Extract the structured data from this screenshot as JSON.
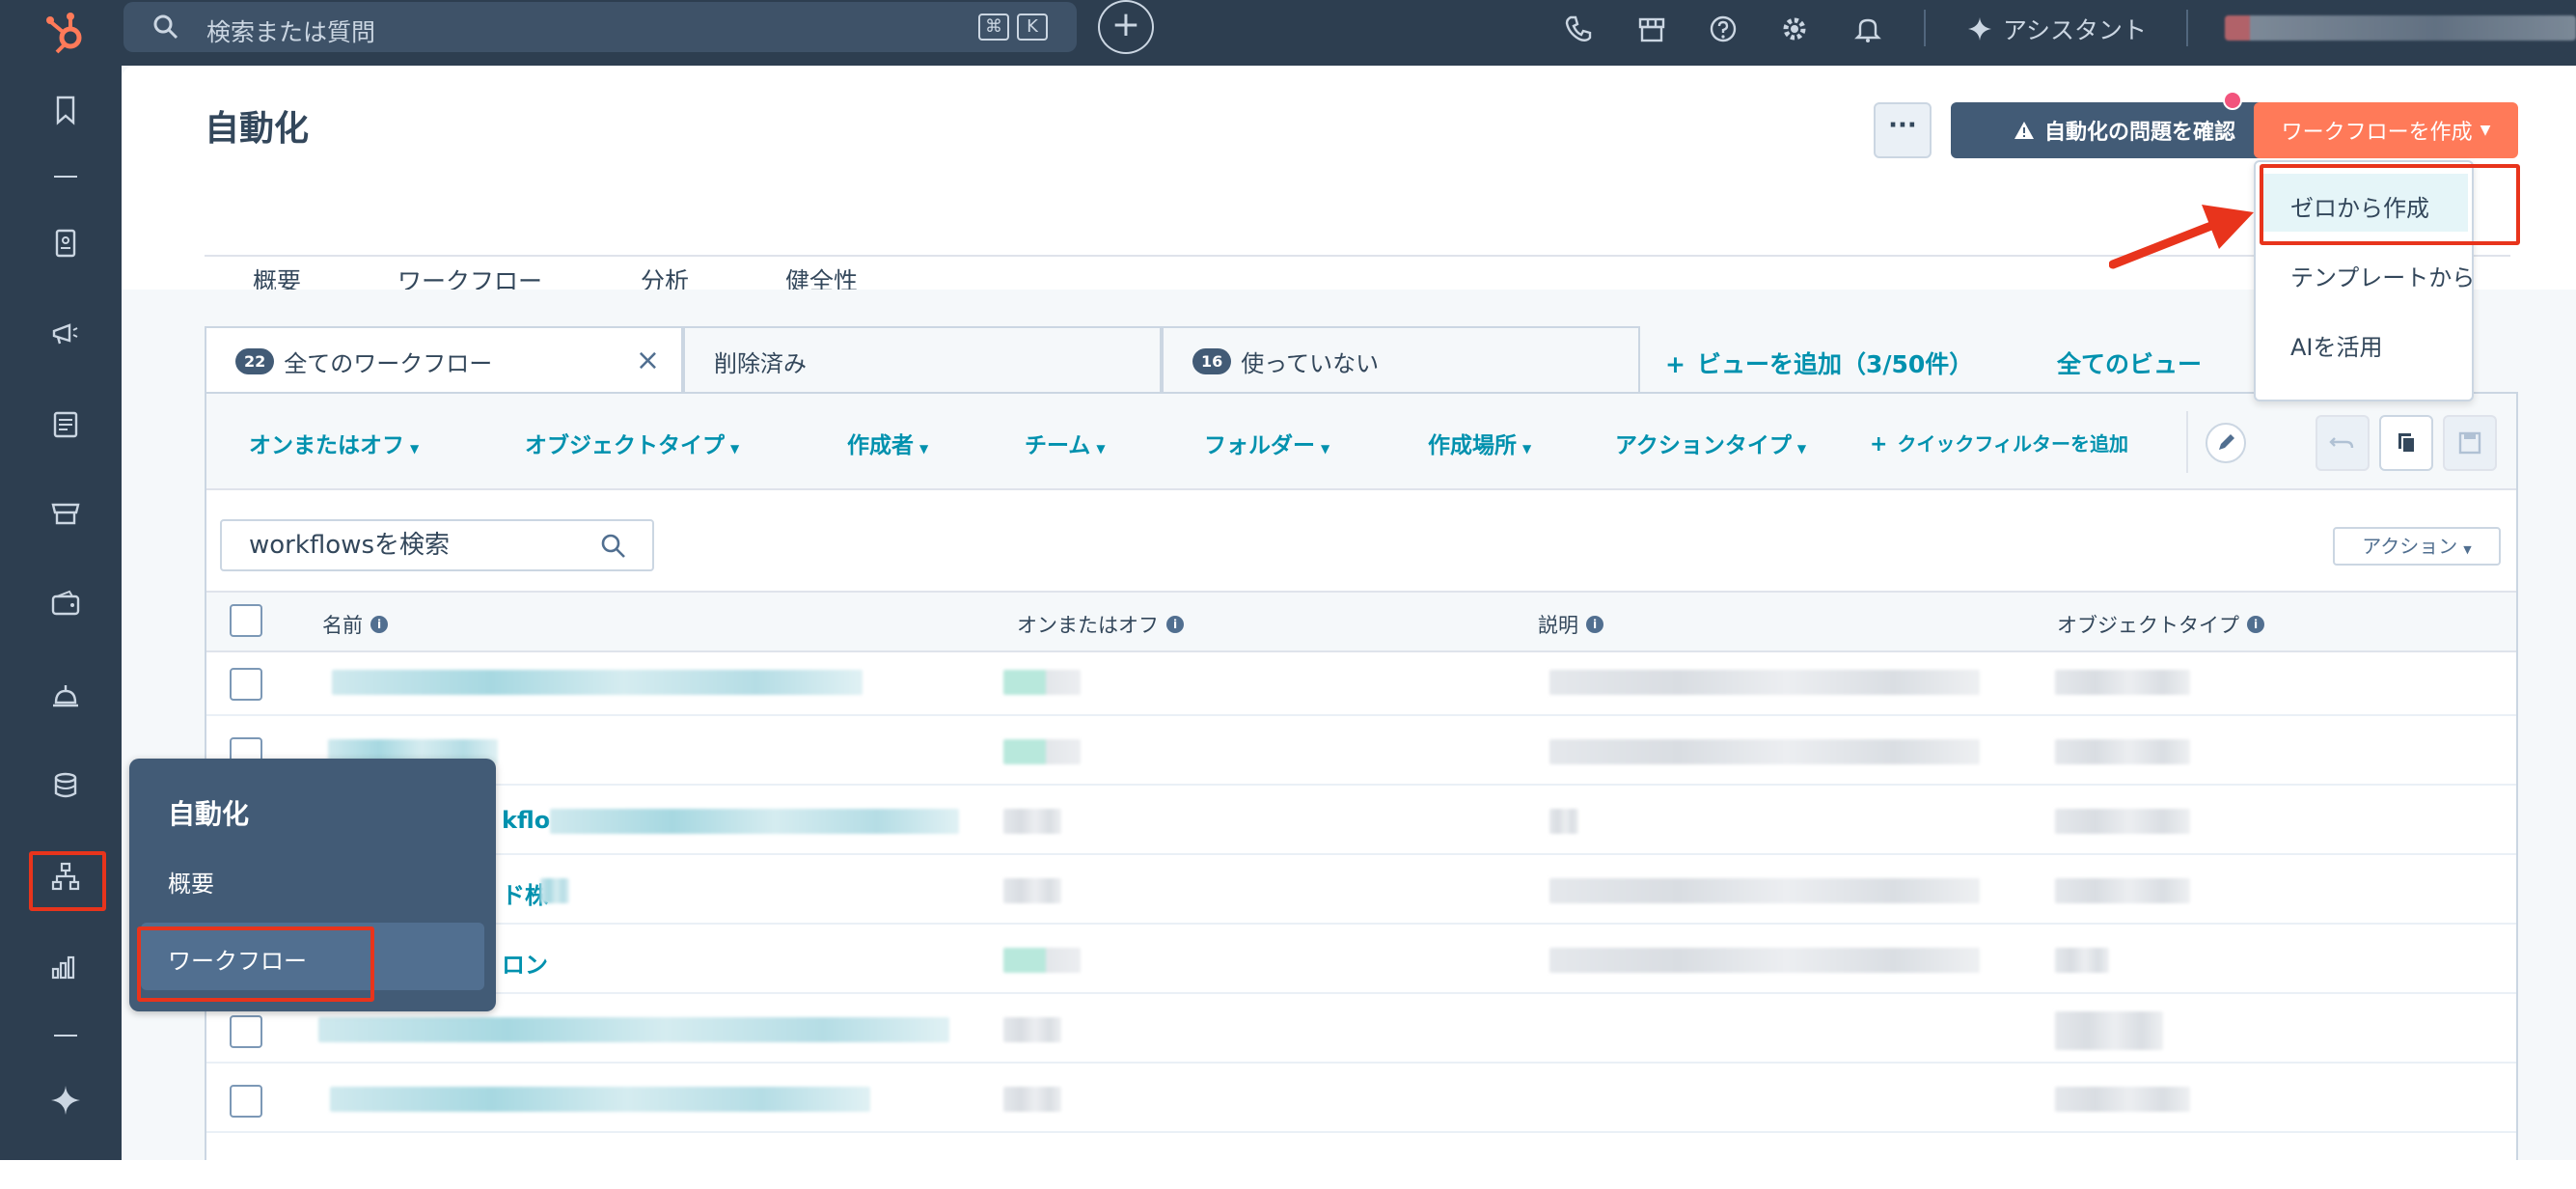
{
  "topbar": {
    "search_placeholder": "検索または質問",
    "kbd_cmd": "⌘",
    "kbd_k": "K",
    "add_label": "+",
    "assistant_label": "アシスタント",
    "icons": [
      "phone-icon",
      "marketplace-icon",
      "help-icon",
      "settings-icon",
      "notifications-icon"
    ]
  },
  "leftnav": {
    "icons": [
      "bookmark-icon",
      "contacts-icon",
      "marketing-icon",
      "content-icon",
      "commerce-icon",
      "sales-icon",
      "service-icon",
      "data-icon",
      "automation-icon",
      "reporting-icon",
      "ai-sparkle-icon"
    ]
  },
  "page": {
    "title": "自動化",
    "more_label": "···",
    "issues_button": "自動化の問題を確認",
    "create_button": "ワークフローを作成",
    "tabs": [
      "概要",
      "ワークフロー",
      "分析",
      "健全性"
    ],
    "active_tab": "ワークフロー"
  },
  "views": {
    "all_count": "22",
    "all_label": "全てのワークフロー",
    "deleted_label": "削除済み",
    "unused_count": "16",
    "unused_label": "使っていない",
    "add_view": "ビューを追加（3/50件）",
    "all_views": "全てのビュー"
  },
  "filters": [
    "オンまたはオフ",
    "オブジェクトタイプ",
    "作成者",
    "チーム",
    "フォルダー",
    "作成場所",
    "アクションタイプ"
  ],
  "quick_filter": "クイックフィルターを追加",
  "search": {
    "placeholder": "workflowsを検索"
  },
  "actions_button": "アクション",
  "table": {
    "columns": [
      "名前",
      "オンまたはオフ",
      "説明",
      "オブジェクトタイプ"
    ],
    "visible_fragments": [
      "kflo",
      "ド株",
      "ロン"
    ]
  },
  "popover": {
    "title": "自動化",
    "items": [
      "概要",
      "ワークフロー"
    ],
    "active": "ワークフロー"
  },
  "dropdown": {
    "items": [
      "ゼロから作成",
      "テンプレートから",
      "AIを活用"
    ],
    "highlighted": "ゼロから作成"
  },
  "colors": {
    "nav_bg": "#2d3e50",
    "accent_orange": "#ff7a59",
    "link_teal": "#0091ae",
    "annotation_red": "#e8341c"
  }
}
